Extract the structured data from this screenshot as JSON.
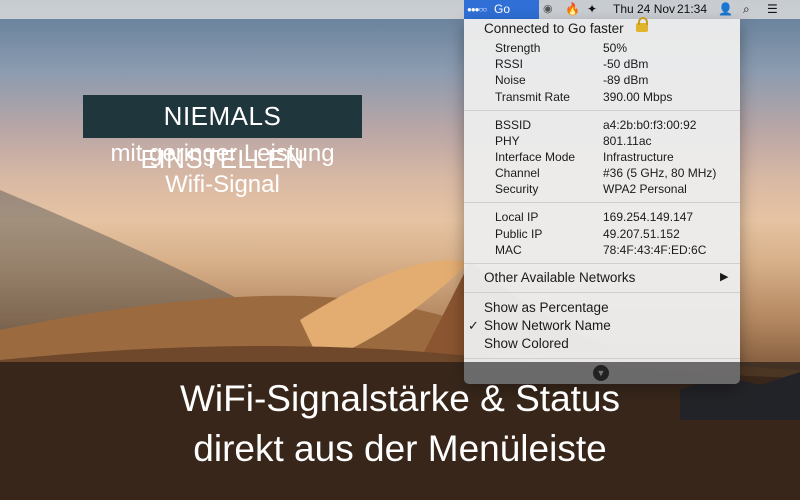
{
  "menubar": {
    "active_item": "Go faster",
    "date": "Thu 24 Nov",
    "time": "21:34",
    "icons": [
      "wifi-signal-dots-icon",
      "battery-dial-icon",
      "flame-icon",
      "vpn-icon",
      "user-icon",
      "spotlight-search-icon",
      "list-menu-icon"
    ]
  },
  "menu": {
    "title": "Connected to Go faster",
    "section1": [
      {
        "label": "Strength",
        "value": "50%"
      },
      {
        "label": "RSSI",
        "value": "-50 dBm"
      },
      {
        "label": "Noise",
        "value": "-89 dBm"
      },
      {
        "label": "Transmit Rate",
        "value": "390.00 Mbps"
      }
    ],
    "section2": [
      {
        "label": "BSSID",
        "value": "a4:2b:b0:f3:00:92"
      },
      {
        "label": "PHY",
        "value": "801.11ac"
      },
      {
        "label": "Interface Mode",
        "value": "Infrastructure"
      },
      {
        "label": "Channel",
        "value": "#36 (5 GHz, 80 MHz)"
      },
      {
        "label": "Security",
        "value": "WPA2 Personal"
      }
    ],
    "section3": [
      {
        "label": "Local IP",
        "value": "169.254.149.147"
      },
      {
        "label": "Public IP",
        "value": "49.207.51.152"
      },
      {
        "label": "MAC",
        "value": "78:4F:43:4F:ED:6C"
      }
    ],
    "other_networks": "Other Available Networks",
    "options": [
      {
        "label": "Show as Percentage",
        "checked": false
      },
      {
        "label": "Show Network Name",
        "checked": true
      },
      {
        "label": "Show Colored",
        "checked": false
      }
    ]
  },
  "overlay": {
    "headline": "NIEMALS EINSTELLEN",
    "sub1": "mit geringer Leistung",
    "sub2": "Wifi-Signal",
    "bottom1": "WiFi-Signalstärke & Status",
    "bottom2": "direkt aus der Menüleiste"
  }
}
